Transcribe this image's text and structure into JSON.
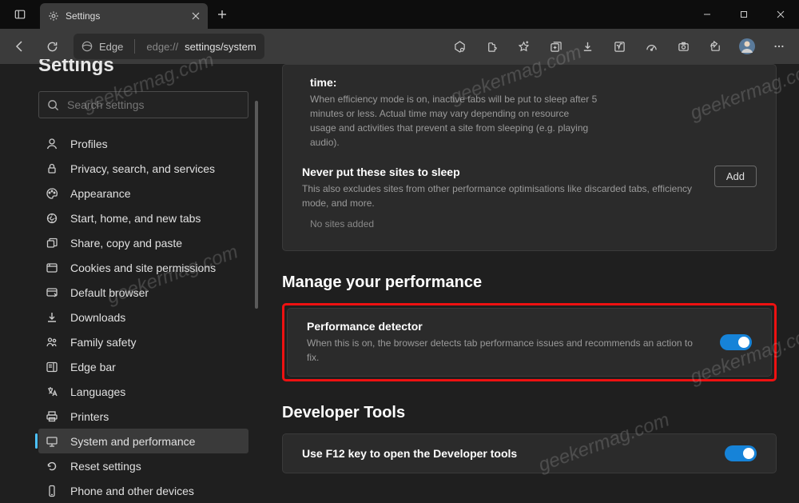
{
  "tab": {
    "title": "Settings"
  },
  "address": {
    "browser": "Edge",
    "url_prefix": "edge://",
    "url_mid": "settings/system"
  },
  "sidebar": {
    "heading_cut": "Settings",
    "search_placeholder": "Search settings",
    "items": [
      {
        "label": "Profiles"
      },
      {
        "label": "Privacy, search, and services"
      },
      {
        "label": "Appearance"
      },
      {
        "label": "Start, home, and new tabs"
      },
      {
        "label": "Share, copy and paste"
      },
      {
        "label": "Cookies and site permissions"
      },
      {
        "label": "Default browser"
      },
      {
        "label": "Downloads"
      },
      {
        "label": "Family safety"
      },
      {
        "label": "Edge bar"
      },
      {
        "label": "Languages"
      },
      {
        "label": "Printers"
      },
      {
        "label": "System and performance"
      },
      {
        "label": "Reset settings"
      },
      {
        "label": "Phone and other devices"
      }
    ]
  },
  "efficiency": {
    "time_label": "time:",
    "time_desc": "When efficiency mode is on, inactive tabs will be put to sleep after 5 minutes or less. Actual time may vary depending on resource usage and activities that prevent a site from sleeping (e.g. playing audio).",
    "never_sleep_title": "Never put these sites to sleep",
    "never_sleep_desc": "This also excludes sites from other performance optimisations like discarded tabs, efficiency mode, and more.",
    "add_button": "Add",
    "no_sites": "No sites added"
  },
  "performance": {
    "heading": "Manage your performance",
    "detector_title": "Performance detector",
    "detector_desc": "When this is on, the browser detects tab performance issues and recommends an action to fix."
  },
  "devtools": {
    "heading": "Developer Tools",
    "f12_title": "Use F12 key to open the Developer tools"
  },
  "watermark": "geekermag.com"
}
